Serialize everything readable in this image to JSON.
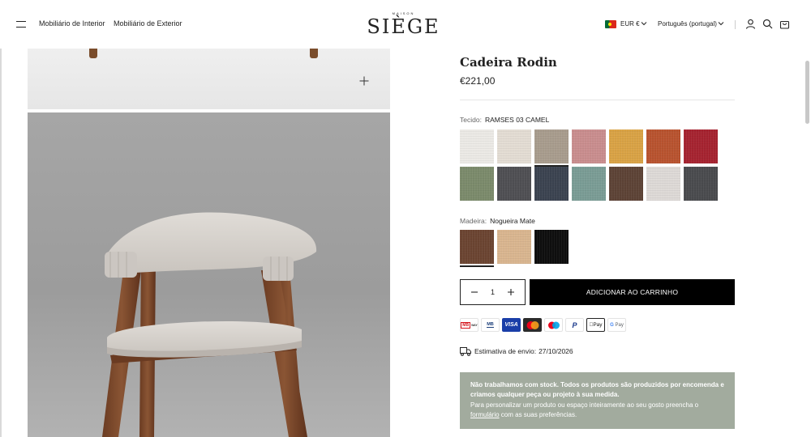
{
  "header": {
    "menu_icon": "hamburger-icon",
    "nav": [
      "Mobiliário de Interior",
      "Mobiliário de Exterior"
    ],
    "logo_small": "MAISON",
    "logo_main": "SIÈGE",
    "currency": "EUR €",
    "language": "Português (portugal)",
    "icons": [
      "account-icon",
      "search-icon",
      "cart-icon"
    ]
  },
  "product": {
    "title": "Cadeira Rodin",
    "price": "€221,00"
  },
  "fabric": {
    "label": "Tecido:",
    "selected": "RAMSES 03 CAMEL",
    "swatches": [
      "#ebe9e5",
      "#e3dcd3",
      "#a89c8d",
      "#c98d8e",
      "#d9a245",
      "#b8532f",
      "#a52330",
      "#7b8a6b",
      "#4f4f53",
      "#3b4350",
      "#7a9c95",
      "#5d4336",
      "#ddd9d6",
      "#4a4b4e"
    ],
    "selected_index": 2
  },
  "wood": {
    "label": "Madeira:",
    "selected": "Nogueira Mate",
    "swatches": [
      "#6b4431",
      "#d9b58f",
      "#0e0e0e"
    ],
    "selected_index": 0
  },
  "quantity": {
    "value": "1",
    "minus": "−",
    "plus": "+"
  },
  "add_to_cart": "ADICIONAR AO CARRINHO",
  "payments": [
    "MB WAY",
    "Multibanco",
    "VISA",
    "Mastercard",
    "Maestro",
    "PayPal",
    "Apple Pay",
    "G Pay"
  ],
  "shipping": {
    "label": "Estimativa de envio:",
    "date": "27/10/2026"
  },
  "info": {
    "bold_line": "Não trabalhamos com stock. Todos os produtos são produzidos por encomenda e criamos qualquer peça ou projeto à sua medida.",
    "text_before_link": "Para personalizar um produto ou espaço inteiramente ao seu gosto preencha o ",
    "link": "formulário",
    "text_after_link": " com as suas preferências."
  }
}
